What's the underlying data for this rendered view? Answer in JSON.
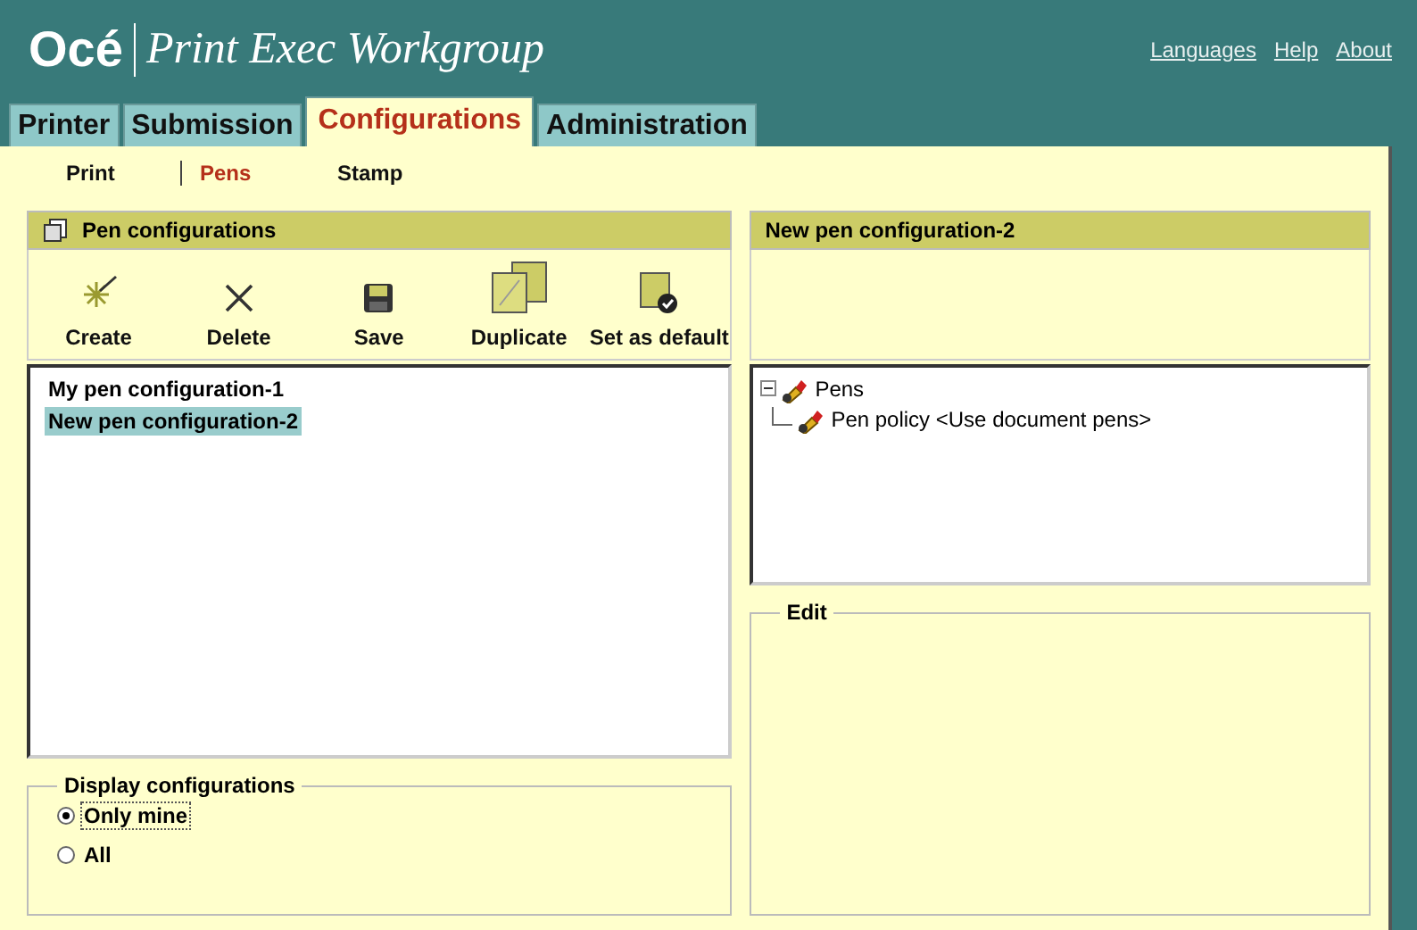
{
  "header": {
    "brand": "Océ",
    "product": "Print Exec Workgroup",
    "links": [
      {
        "label": "Languages"
      },
      {
        "label": "Help"
      },
      {
        "label": "About"
      }
    ]
  },
  "tabs": [
    {
      "label": "Printer",
      "selected": false
    },
    {
      "label": "Submission",
      "selected": false
    },
    {
      "label": "Configurations",
      "selected": true
    },
    {
      "label": "Administration",
      "selected": false
    }
  ],
  "subtabs": [
    {
      "label": "Print",
      "selected": false
    },
    {
      "label": "Pens",
      "selected": true
    },
    {
      "label": "Stamp",
      "selected": false
    }
  ],
  "left_panel": {
    "title": "Pen configurations",
    "toolbar": [
      {
        "kind": "create",
        "label": "Create"
      },
      {
        "kind": "delete",
        "label": "Delete"
      },
      {
        "kind": "save",
        "label": "Save"
      },
      {
        "kind": "duplicate",
        "label": "Duplicate"
      },
      {
        "kind": "default",
        "label": "Set as default"
      }
    ],
    "items": [
      {
        "label": "My pen configuration-1",
        "selected": false
      },
      {
        "label": "New pen configuration-2",
        "selected": true
      }
    ],
    "display": {
      "title": "Display configurations",
      "options": [
        {
          "label": "Only mine",
          "selected": true
        },
        {
          "label": "All",
          "selected": false
        }
      ]
    }
  },
  "right_panel": {
    "title": "New pen configuration-2",
    "tree": [
      {
        "label": "Pens",
        "expanded": true,
        "children": [
          {
            "label": "Pen policy <Use document pens>"
          }
        ]
      }
    ],
    "edit": {
      "title": "Edit"
    }
  }
}
